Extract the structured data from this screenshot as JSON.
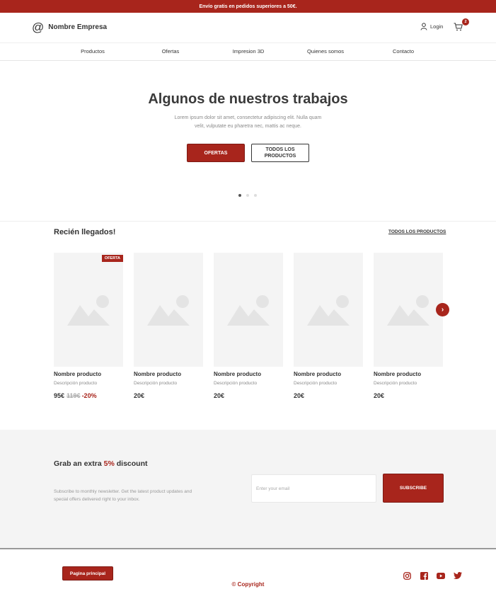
{
  "topbar": {
    "text": "Envío gratis en pedidos superiores a 50€."
  },
  "header": {
    "brand_symbol": "@",
    "brand_name": "Nombre Empresa",
    "login_label": "Login",
    "cart_count": "2"
  },
  "nav": {
    "items": [
      "Productos",
      "Ofertas",
      "Impresion 3D",
      "Quienes somos",
      "Contacto"
    ]
  },
  "hero": {
    "title": "Algunos de nuestros trabajos",
    "text": "Lorem ipsum dolor sit amet, consectetur adipiscing elit. Nulla quam velit, vulputate eu pharetra nec, mattis ac neque.",
    "primary_button": "OFERTAS",
    "secondary_button": "TODOS LOS PRODUCTOS",
    "slide_count": 3,
    "active_slide": 1
  },
  "new_arrivals": {
    "title": "Recién llegados!",
    "link": "TODOS LOS PRODUCTOS",
    "products": [
      {
        "name": "Nombre producto",
        "description": "Descripción producto",
        "price": "95€",
        "old_price": "119€",
        "discount": "-20%",
        "badge": "OFERTA"
      },
      {
        "name": "Nombre producto",
        "description": "Descripción producto",
        "price": "20€"
      },
      {
        "name": "Nombre producto",
        "description": "Descripción producto",
        "price": "20€"
      },
      {
        "name": "Nombre producto",
        "description": "Descripción producto",
        "price": "20€"
      },
      {
        "name": "Nombre producto",
        "description": "Descripción producto",
        "price": "20€"
      }
    ],
    "next_arrow": "›"
  },
  "newsletter": {
    "title_before": "Grab an extra",
    "title_highlight": "5%",
    "title_after": "discount",
    "text": "Subscribe to monthly newsletter. Get the latest product updates and special offers delivered right to your inbox.",
    "input_placeholder": "Enter your email",
    "button": "SUBSCRIBE"
  },
  "footer": {
    "home_button": "Pagina principal",
    "copyright": "© Copyright",
    "socials": [
      "instagram-icon",
      "facebook-icon",
      "youtube-icon",
      "twitter-icon"
    ]
  },
  "colors": {
    "accent": "#a8251c",
    "placeholder_bg": "#f4f4f4"
  }
}
